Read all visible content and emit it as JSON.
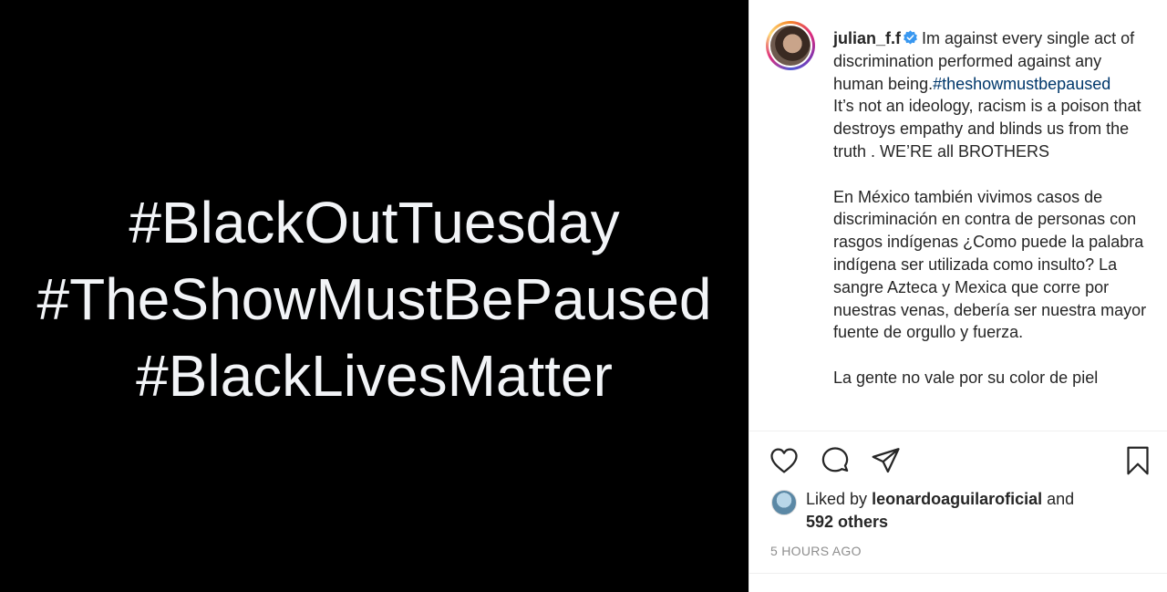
{
  "post": {
    "image_lines": [
      "#BlackOutTuesday",
      "#TheShowMustBePaused",
      "#BlackLivesMatter"
    ]
  },
  "caption": {
    "username": "julian_f.f",
    "text_1": "Im against every single act of discrimination performed against any human being.",
    "hashtag": "#theshowmustbepaused",
    "text_2": "It’s not an ideology, racism is a poison that destroys empathy and blinds us from the truth . WE’RE all BROTHERS",
    "text_3": "En México también vivimos casos de discriminación en contra de personas con rasgos indígenas ¿Como puede la palabra indígena ser utilizada como insulto? La sangre Azteca y Mexica que corre por nuestras venas, debería ser nuestra mayor fuente de orgullo y fuerza.",
    "text_4": "La gente no vale por su color de piel"
  },
  "icons": {
    "like": "heart-icon",
    "comment": "comment-icon",
    "share": "share-icon",
    "save": "bookmark-icon",
    "verified": "verified-badge-icon"
  },
  "likes": {
    "prefix": "Liked by",
    "user": "leonardoaguilaroficial",
    "and": "and",
    "others": "592 others"
  },
  "timestamp": "5 HOURS AGO",
  "colors": {
    "hashtag": "#00376b",
    "verified": "#3897f0",
    "text": "#262626",
    "muted": "#8e8e8e"
  }
}
